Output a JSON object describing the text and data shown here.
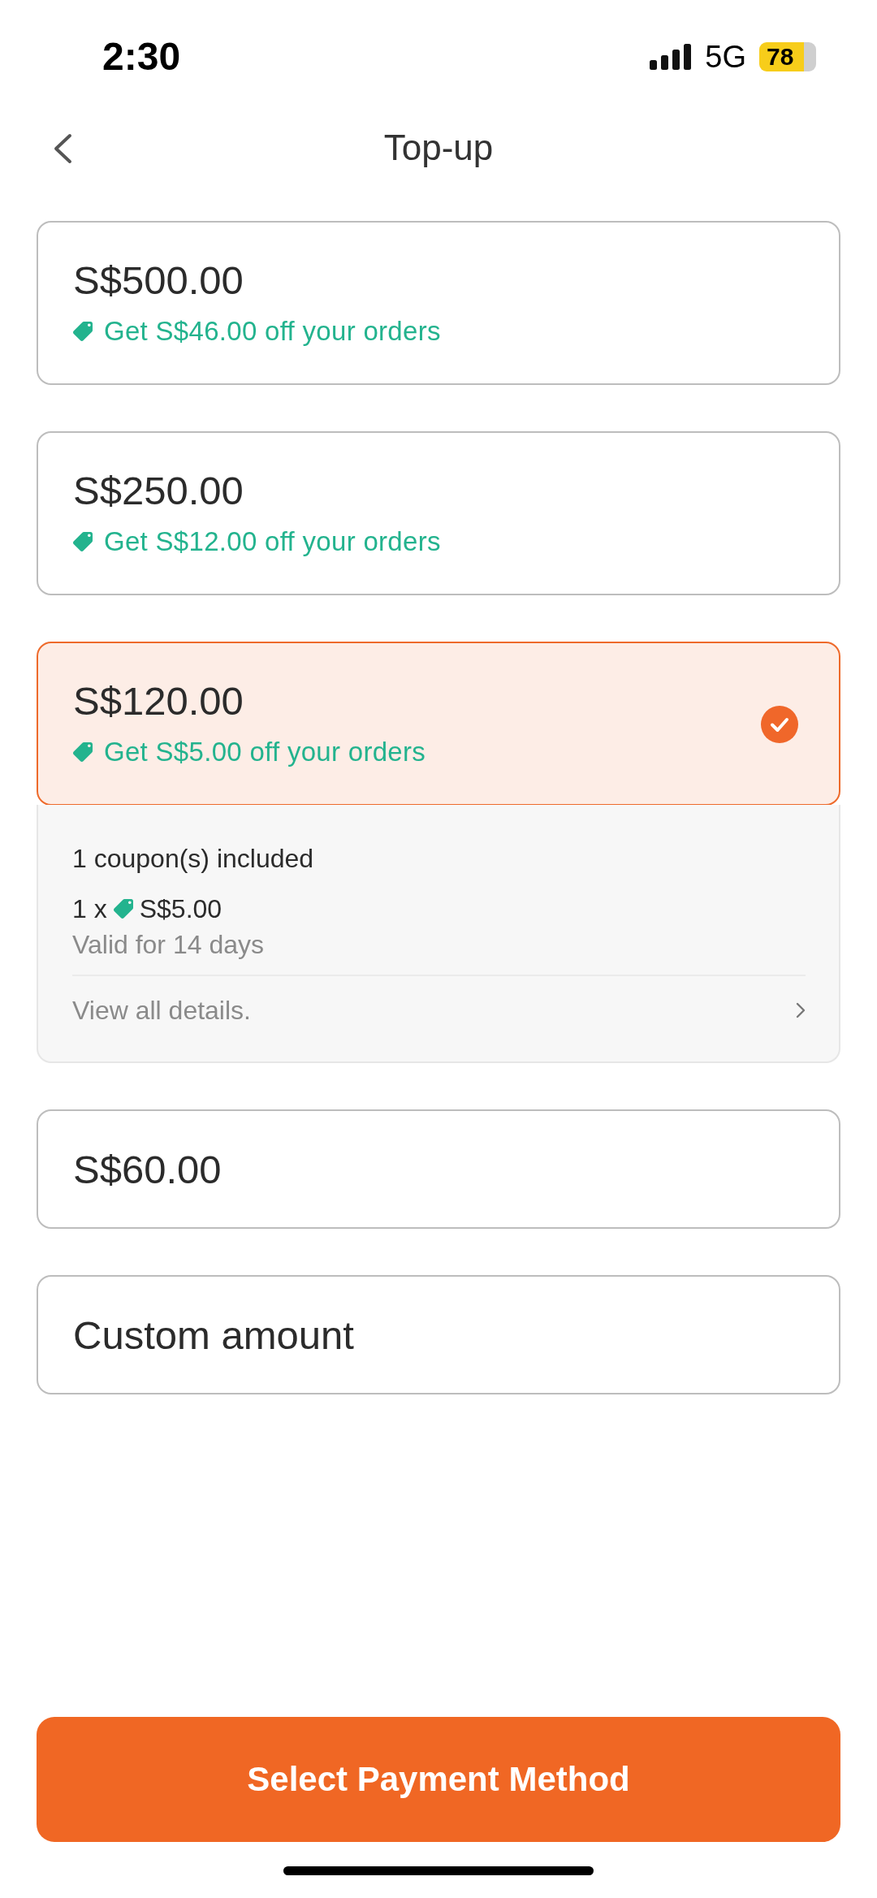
{
  "status_bar": {
    "time": "2:30",
    "network": "5G",
    "battery": "78"
  },
  "header": {
    "title": "Top-up"
  },
  "options": [
    {
      "amount": "S$500.00",
      "offer": "Get S$46.00 off your orders",
      "selected": false
    },
    {
      "amount": "S$250.00",
      "offer": "Get S$12.00 off your orders",
      "selected": false
    },
    {
      "amount": "S$120.00",
      "offer": "Get S$5.00 off your orders",
      "selected": true,
      "details": {
        "coupons_included": "1 coupon(s) included",
        "coupon_quantity": "1 x",
        "coupon_value": "S$5.00",
        "validity": "Valid for 14 days",
        "link": "View all details."
      }
    },
    {
      "amount": "S$60.00",
      "selected": false
    },
    {
      "amount": "Custom amount",
      "selected": false
    }
  ],
  "primary_button": {
    "label": "Select Payment Method"
  }
}
